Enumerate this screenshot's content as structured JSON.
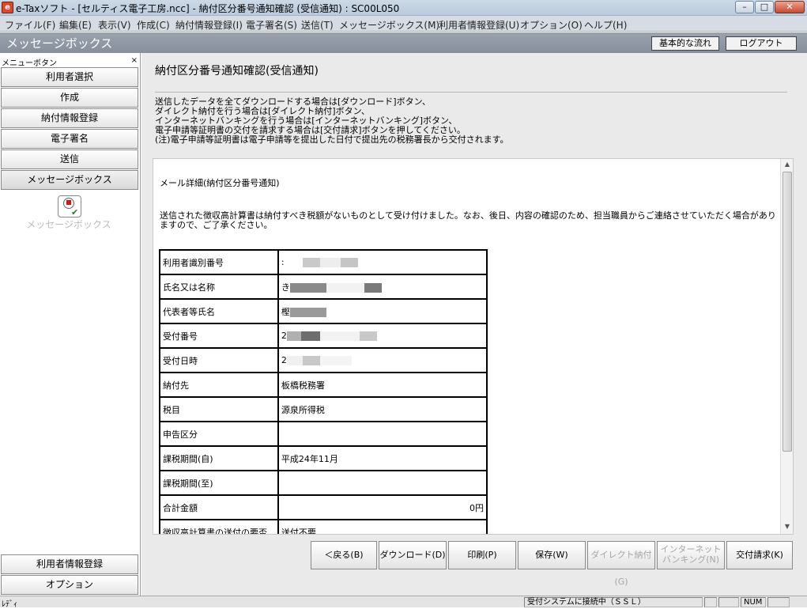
{
  "window": {
    "icon_text": "e",
    "title": "e-Taxソフト - [セルティス電子工房.ncc] - 納付区分番号通知確認 (受信通知) : SC00L050",
    "min": "–",
    "max": "□",
    "close": "✕"
  },
  "menu": {
    "items": [
      "ファイル(F)",
      "編集(E)",
      "表示(V)",
      "作成(C)",
      "納付情報登録(I)",
      "電子署名(S)",
      "送信(T)",
      "メッセージボックス(M)",
      "利用者情報登録(U)",
      "オプション(O)",
      "ヘルプ(H)"
    ]
  },
  "header": {
    "title": "メッセージボックス",
    "basic_flow_label": "基本的な流れ",
    "logout_label": "ログアウト"
  },
  "sidebar": {
    "heading": "メニューボタン",
    "close": "×",
    "items": [
      "利用者選択",
      "作成",
      "納付情報登録",
      "電子署名",
      "送信",
      "メッセージボックス"
    ],
    "active_label": "メッセージボックス",
    "bottom_items": [
      "利用者情報登録",
      "オプション"
    ]
  },
  "main": {
    "title": "納付区分番号通知確認(受信通知)",
    "instructions": "送信したデータを全てダウンロードする場合は[ダウンロード]ボタン、\nダイレクト納付を行う場合は[ダイレクト納付]ボタン、\nインターネットバンキングを行う場合は[インターネットバンキング]ボタン、\n電子申請等証明書の交付を請求する場合は[交付請求]ボタンを押してください。\n(注)電子申請等証明書は電子申請等を提出した日付で提出先の税務署長から交付されます。",
    "mail_detail_title": "メール詳細(納付区分番号通知)",
    "notice": "送信された徴収高計算書は納付すべき税額がないものとして受け付けました。なお、後日、内容の確認のため、担当職員からご連絡させていただく場合がありますので、ご了承ください。",
    "details": [
      {
        "label": "利用者識別番号",
        "value": ":"
      },
      {
        "label": "氏名又は名称",
        "value": "き"
      },
      {
        "label": "代表者等氏名",
        "value": "樫"
      },
      {
        "label": "受付番号",
        "value": "2"
      },
      {
        "label": "受付日時",
        "value": "2"
      },
      {
        "label": "納付先",
        "value": "板橋税務署"
      },
      {
        "label": "税目",
        "value": "源泉所得税"
      },
      {
        "label": "申告区分",
        "value": ""
      },
      {
        "label": "課税期間(自)",
        "value": "平成24年11月"
      },
      {
        "label": "課税期間(至)",
        "value": ""
      },
      {
        "label": "合計金額",
        "value": "0円"
      },
      {
        "label": "徴収高計算書の送付の要否",
        "value": "送付不要"
      }
    ]
  },
  "actions": {
    "back": "＜戻る(B)",
    "download": "ダウンロード(D)",
    "print": "印刷(P)",
    "save": "保存(W)",
    "direct_pay": "ダイレクト納付(G)",
    "inet_bank_1": "インターネット",
    "inet_bank_2": "バンキング(N)",
    "request": "交付請求(K)"
  },
  "status": {
    "left": "ﾚﾃﾞｨ",
    "connection": "受付システムに接続中（ＳＳＬ）",
    "num": "NUM"
  }
}
